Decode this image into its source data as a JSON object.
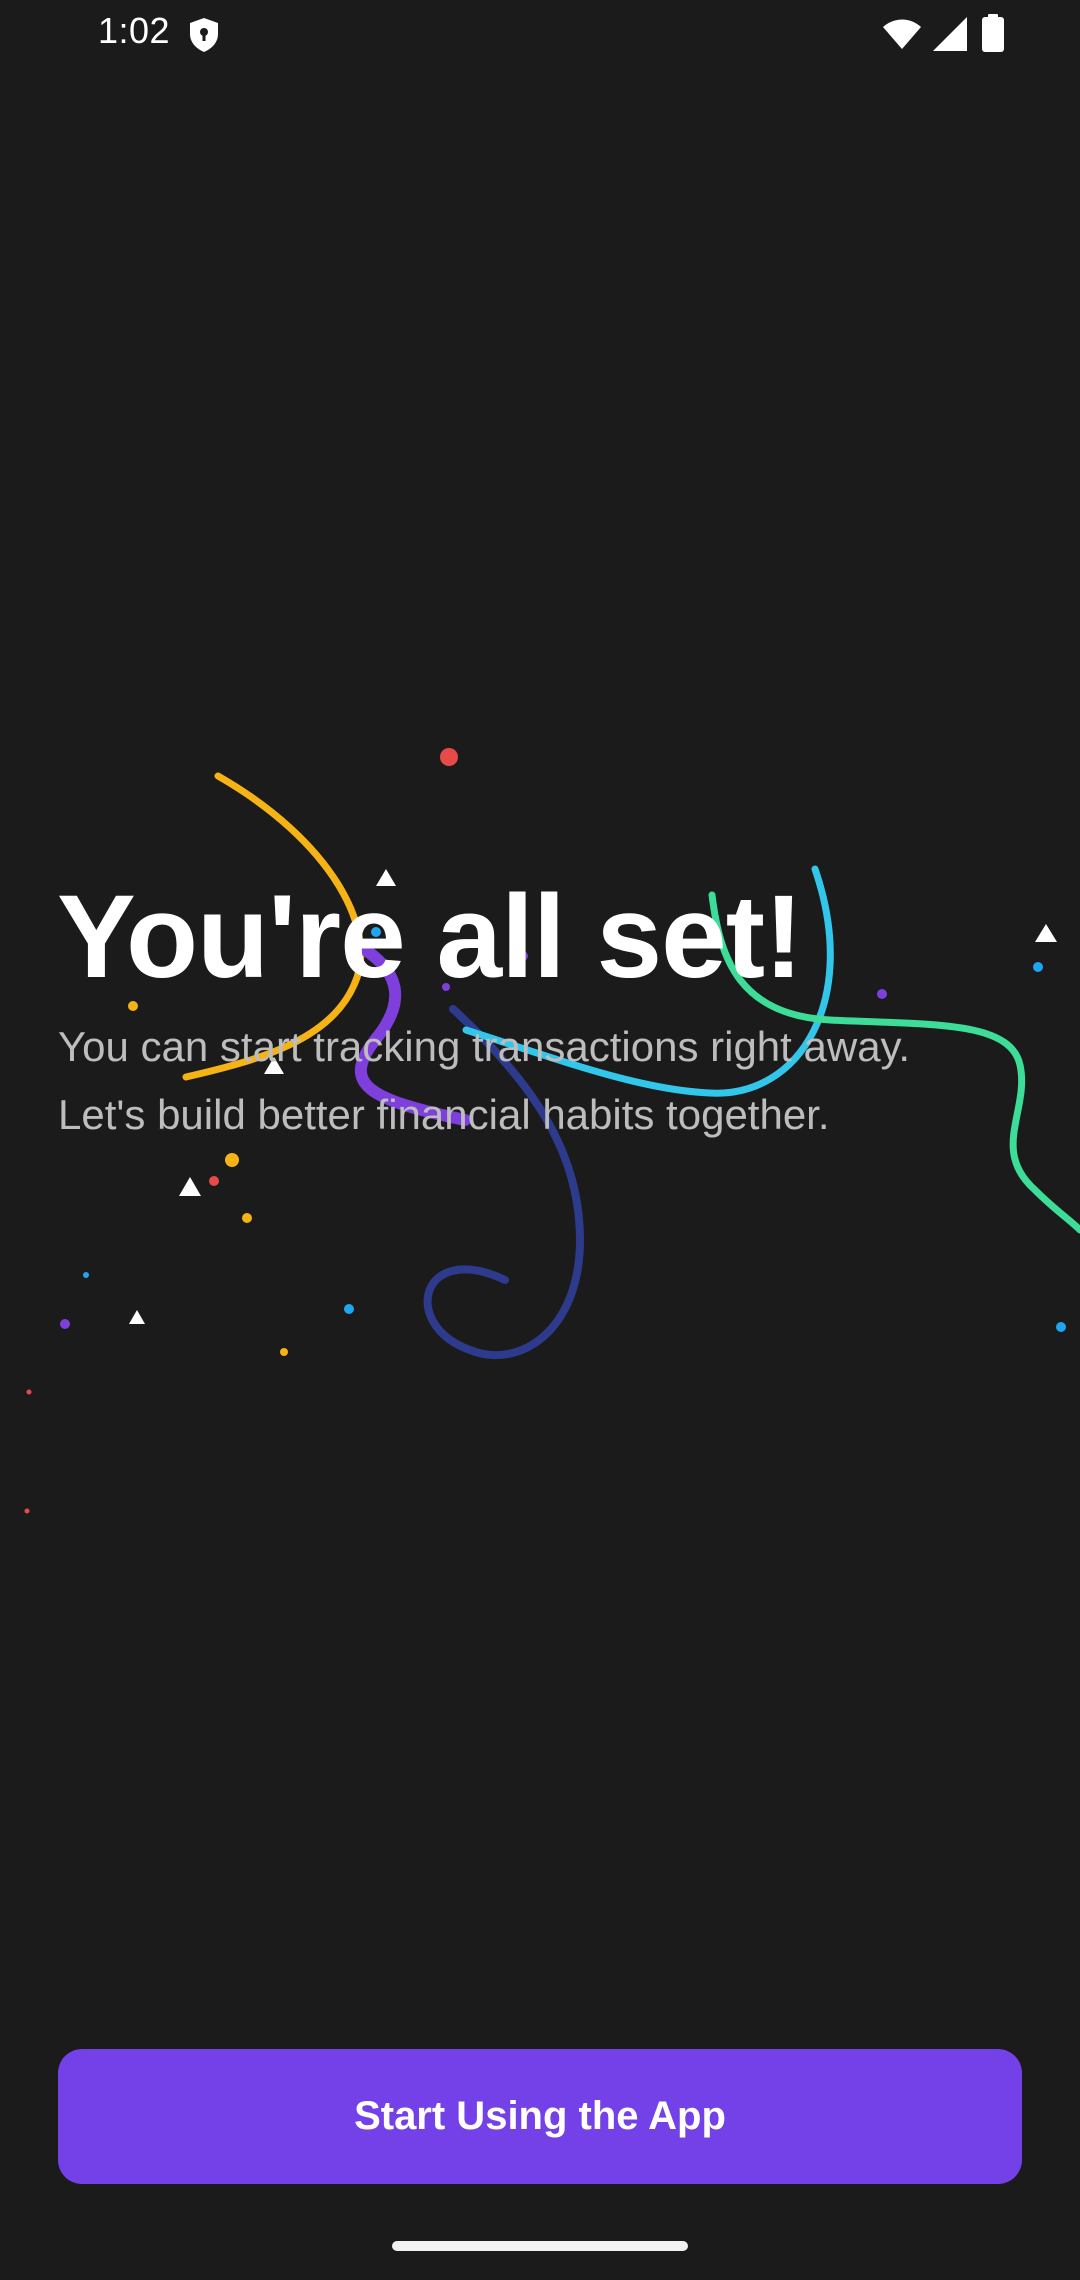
{
  "status_bar": {
    "time": "1:02",
    "icons": [
      "shield-icon",
      "wifi-icon",
      "cellular-signal-icon",
      "battery-icon"
    ]
  },
  "onboarding": {
    "title": "You're all set!",
    "subtitle": "You can start tracking transactions right away. Let's build better financial habits together."
  },
  "primary_action": {
    "label": "Start Using the App"
  },
  "colors": {
    "background": "#1b1b1c",
    "accent": "#7440e8",
    "title_text": "#ffffff",
    "body_text": "#bdbdbd",
    "confetti": [
      "#f5b316",
      "#7f3fdc",
      "#2e3a8c",
      "#32c7ea",
      "#3ddc97",
      "#e84a4a",
      "#1fa6f2",
      "#ffffff"
    ]
  }
}
